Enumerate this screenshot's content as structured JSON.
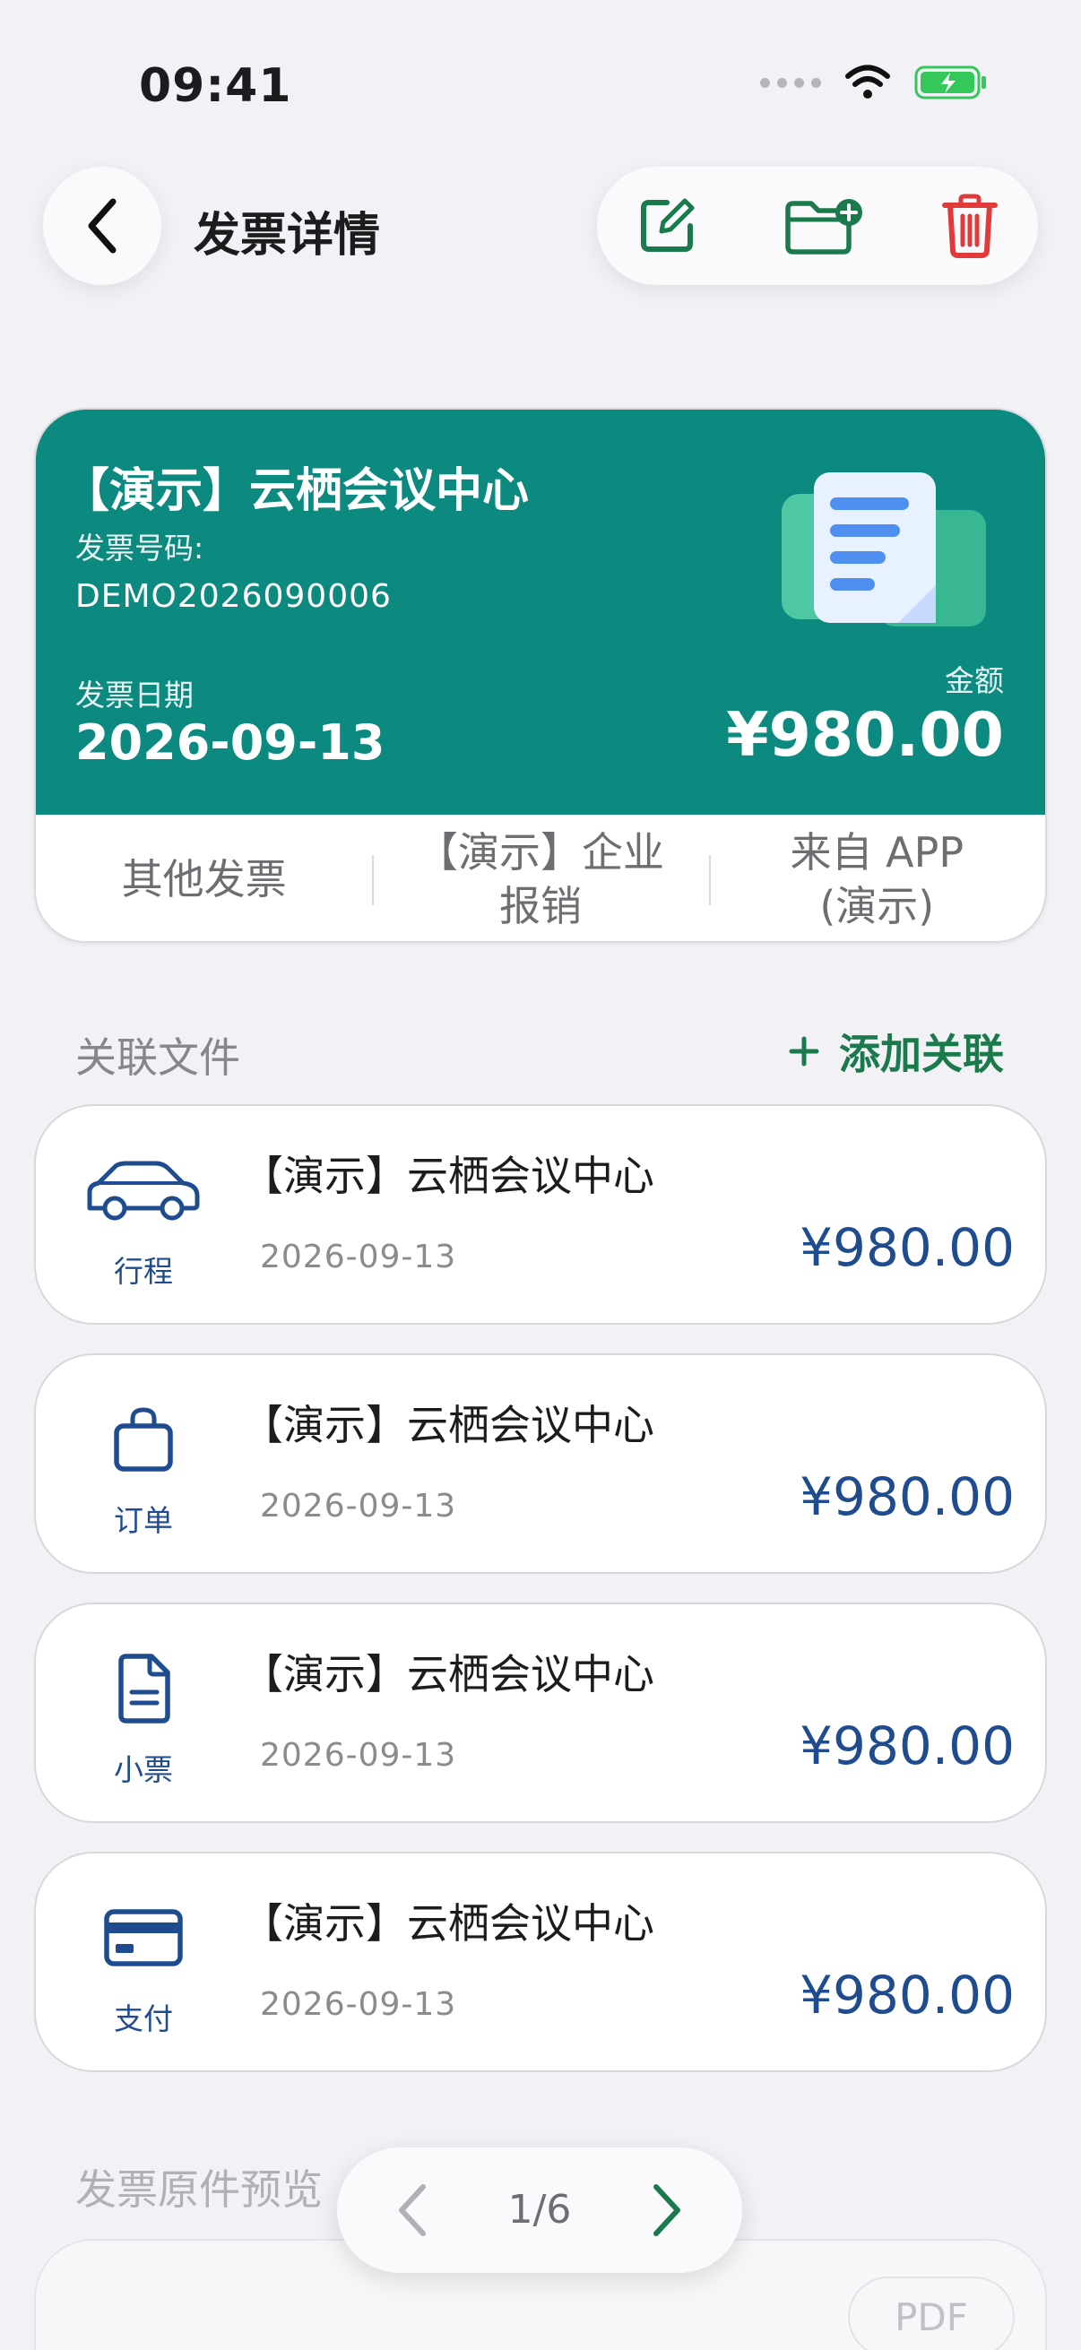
{
  "status_bar": {
    "time": "09:41"
  },
  "nav": {
    "title": "发票详情"
  },
  "invoice": {
    "title": "【演示】云栖会议中心",
    "number_label": "发票号码:",
    "number": "DEMO2026090006",
    "date_label": "发票日期",
    "date": "2026-09-13",
    "amount_label": "金额",
    "amount": "¥980.00",
    "tags": [
      {
        "line1": "其他发票",
        "line2": ""
      },
      {
        "line1": "【演示】企业",
        "line2": "报销"
      },
      {
        "line1": "来自 APP",
        "line2": "(演示)"
      }
    ]
  },
  "linked": {
    "title": "关联文件",
    "add_label": "添加关联",
    "items": [
      {
        "icon": "car-icon",
        "kind": "行程",
        "title": "【演示】云栖会议中心",
        "date": "2026-09-13",
        "amount": "¥980.00"
      },
      {
        "icon": "shopping-bag-icon",
        "kind": "订单",
        "title": "【演示】云栖会议中心",
        "date": "2026-09-13",
        "amount": "¥980.00"
      },
      {
        "icon": "receipt-document-icon",
        "kind": "小票",
        "title": "【演示】云栖会议中心",
        "date": "2026-09-13",
        "amount": "¥980.00"
      },
      {
        "icon": "credit-card-icon",
        "kind": "支付",
        "title": "【演示】云栖会议中心",
        "date": "2026-09-13",
        "amount": "¥980.00"
      }
    ]
  },
  "preview": {
    "title": "发票原件预览",
    "badge": "PDF"
  },
  "pager": {
    "text": "1/6"
  },
  "colors": {
    "header_teal": "#0d8a80",
    "accent_green": "#1b7a4c",
    "link_blue": "#1f4c8f",
    "delete_red": "#e03a3a"
  }
}
